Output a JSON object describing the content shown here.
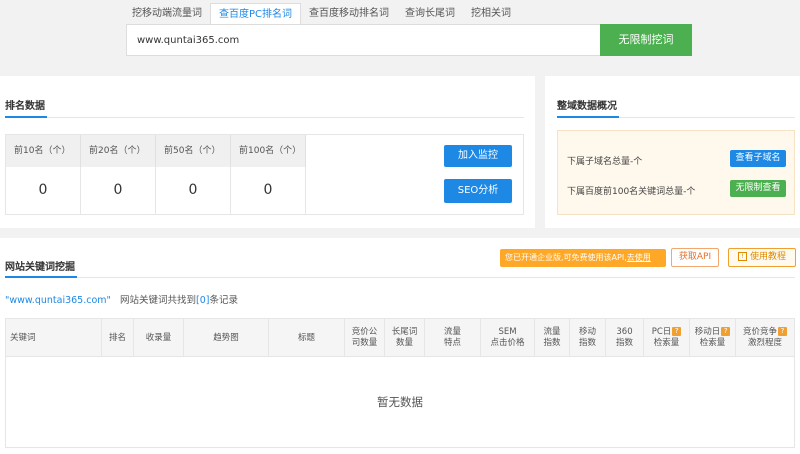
{
  "tabs": [
    {
      "label": "挖移动端流量词"
    },
    {
      "label": "查百度PC排名词"
    },
    {
      "label": "查百度移动排名词"
    },
    {
      "label": "查询长尾词"
    },
    {
      "label": "挖相关词"
    }
  ],
  "active_tab": 1,
  "search": {
    "value": "www.quntai365.com",
    "button": "无限制挖词"
  },
  "rank": {
    "title": "排名数据",
    "headers": [
      "前10名（个）",
      "前20名（个）",
      "前50名（个）",
      "前100名（个）"
    ],
    "values": [
      "0",
      "0",
      "0",
      "0"
    ],
    "btn_monitor": "加入监控",
    "btn_seo": "SEO分析"
  },
  "overview": {
    "title": "整域数据概况",
    "line1": "下属子域名总量-个",
    "btn1": "查看子域名",
    "line2": "下属百度前100名关键词总量-个",
    "btn2": "无限制查看"
  },
  "keywords": {
    "title": "网站关键词挖掘",
    "promo_text": "您已开通企业版,可免费使用该API,",
    "promo_link": "去使用",
    "api_btn": "获取API",
    "tutorial_btn": "使用教程",
    "summary_domain": "\"www.quntai365.com\"",
    "summary_pre": "网站关键词共找到",
    "summary_count": "[0]",
    "summary_post": "条记录",
    "columns": [
      {
        "l1": "关键词",
        "l2": ""
      },
      {
        "l1": "排名",
        "l2": ""
      },
      {
        "l1": "收录量",
        "l2": ""
      },
      {
        "l1": "趋势图",
        "l2": ""
      },
      {
        "l1": "标题",
        "l2": ""
      },
      {
        "l1": "竞价公",
        "l2": "司数量"
      },
      {
        "l1": "长尾词",
        "l2": "数量"
      },
      {
        "l1": "流量",
        "l2": "特点"
      },
      {
        "l1": "SEM",
        "l2": "点击价格"
      },
      {
        "l1": "流量",
        "l2": "指数"
      },
      {
        "l1": "移动",
        "l2": "指数"
      },
      {
        "l1": "360",
        "l2": "指数"
      },
      {
        "l1": "PC日",
        "l2": "检索量"
      },
      {
        "l1": "移动日",
        "l2": "检索量"
      },
      {
        "l1": "竞价竞争",
        "l2": "激烈程度"
      }
    ],
    "empty_text": "暂无数据"
  },
  "colors": {
    "accent": "#1e88e5",
    "green": "#4caf50",
    "orange": "#ffa726"
  }
}
